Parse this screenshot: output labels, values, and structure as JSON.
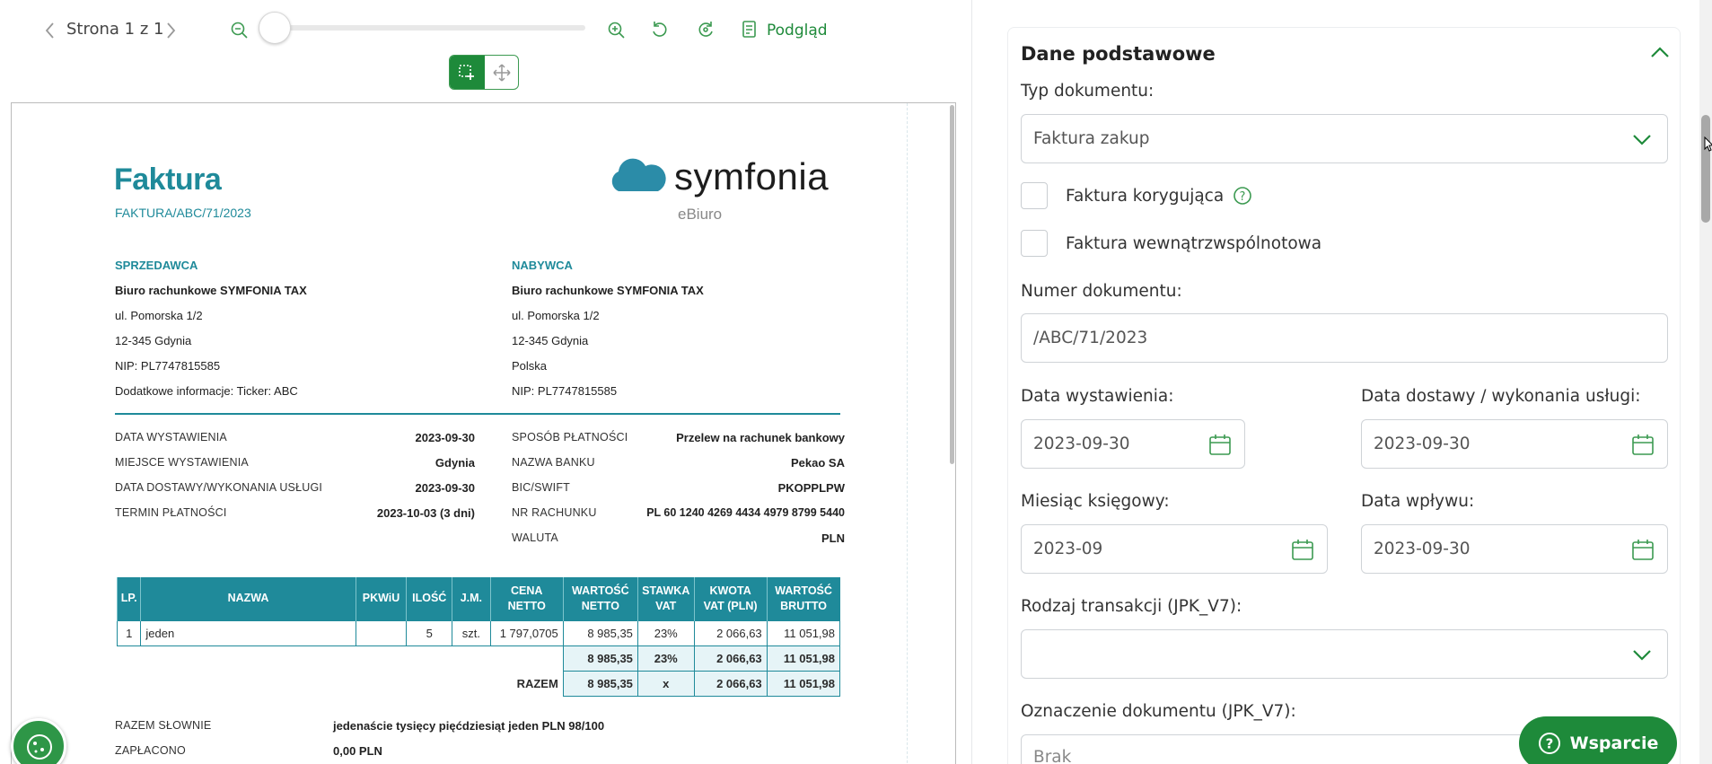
{
  "toolbar": {
    "page_label": "Strona 1 z 1",
    "preview_label": "Podgląd",
    "zoom_level": 0.0
  },
  "document": {
    "title": "Faktura",
    "number": "FAKTURA/ABC/71/2023",
    "logo_text": "symfonia",
    "logo_sub": "eBiuro",
    "seller": {
      "header": "SPRZEDAWCA",
      "name": "Biuro rachunkowe SYMFONIA TAX",
      "street": "ul. Pomorska 1/2",
      "city": "12-345 Gdynia",
      "nip": "NIP: PL7747815585",
      "extra": "Dodatkowe informacje: Ticker: ABC"
    },
    "buyer": {
      "header": "NABYWCA",
      "name": "Biuro rachunkowe SYMFONIA TAX",
      "street": "ul. Pomorska 1/2",
      "city": "12-345 Gdynia",
      "country": "Polska",
      "nip": "NIP: PL7747815585"
    },
    "details_left": [
      {
        "label": "DATA WYSTAWIENIA",
        "value": "2023-09-30"
      },
      {
        "label": "MIEJSCE WYSTAWIENIA",
        "value": "Gdynia"
      },
      {
        "label": "DATA DOSTAWY/WYKONANIA USŁUGI",
        "value": "2023-09-30"
      },
      {
        "label": "TERMIN PŁATNOŚCI",
        "value": "2023-10-03 (3 dni)"
      }
    ],
    "details_right": [
      {
        "label": "SPOSÓB PŁATNOŚCI",
        "value": "Przelew na rachunek bankowy"
      },
      {
        "label": "NAZWA BANKU",
        "value": "Pekao SA"
      },
      {
        "label": "BIC/SWIFT",
        "value": "PKOPPLPW"
      },
      {
        "label": "NR RACHUNKU",
        "value": "PL 60 1240 4269 4434 4979 8799 5440"
      },
      {
        "label": "WALUTA",
        "value": "PLN"
      }
    ],
    "table": {
      "headers": [
        "LP.",
        "NAZWA",
        "PKWiU",
        "ILOŚĆ",
        "J.M.",
        "CENA NETTO",
        "WARTOŚĆ NETTO",
        "STAWKA VAT",
        "KWOTA VAT (PLN)",
        "WARTOŚĆ BRUTTO"
      ],
      "rows": [
        [
          "1",
          "jeden",
          "",
          "5",
          "szt.",
          "1 797,0705",
          "8 985,35",
          "23%",
          "2 066,63",
          "11 051,98"
        ]
      ],
      "subtotal": [
        "8 985,35",
        "23%",
        "2 066,63",
        "11 051,98"
      ],
      "total_label": "RAZEM",
      "total": [
        "8 985,35",
        "x",
        "2 066,63",
        "11 051,98"
      ]
    },
    "words_label": "RAZEM SŁOWNIE",
    "words_value": "jedenaście tysięcy pięćdziesiąt jeden PLN 98/100",
    "paid_label": "ZAPŁACONO",
    "paid_value": "0,00 PLN"
  },
  "panel": {
    "section_title": "Dane podstawowe",
    "doc_type_label": "Typ dokumentu:",
    "doc_type_value": "Faktura zakup",
    "corrective_label": "Faktura korygująca",
    "intra_label": "Faktura wewnątrzwspólnotowa",
    "doc_number_label": "Numer dokumentu:",
    "doc_number_value": "/ABC/71/2023",
    "issue_date_label": "Data wystawienia:",
    "issue_date_value": "2023-09-30",
    "delivery_date_label": "Data dostawy / wykonania usługi:",
    "delivery_date_value": "2023-09-30",
    "month_label": "Miesiąc księgowy:",
    "month_value": "2023-09",
    "receipt_date_label": "Data wpływu:",
    "receipt_date_value": "2023-09-30",
    "transaction_label": "Rodzaj transakcji (JPK_V7):",
    "transaction_value": "",
    "marking_label": "Oznaczenie dokumentu (JPK_V7):",
    "marking_value": "Brak"
  },
  "support_label": "Wsparcie",
  "colors": {
    "accent": "#1e8a3a",
    "teal": "#1f8a9a"
  }
}
